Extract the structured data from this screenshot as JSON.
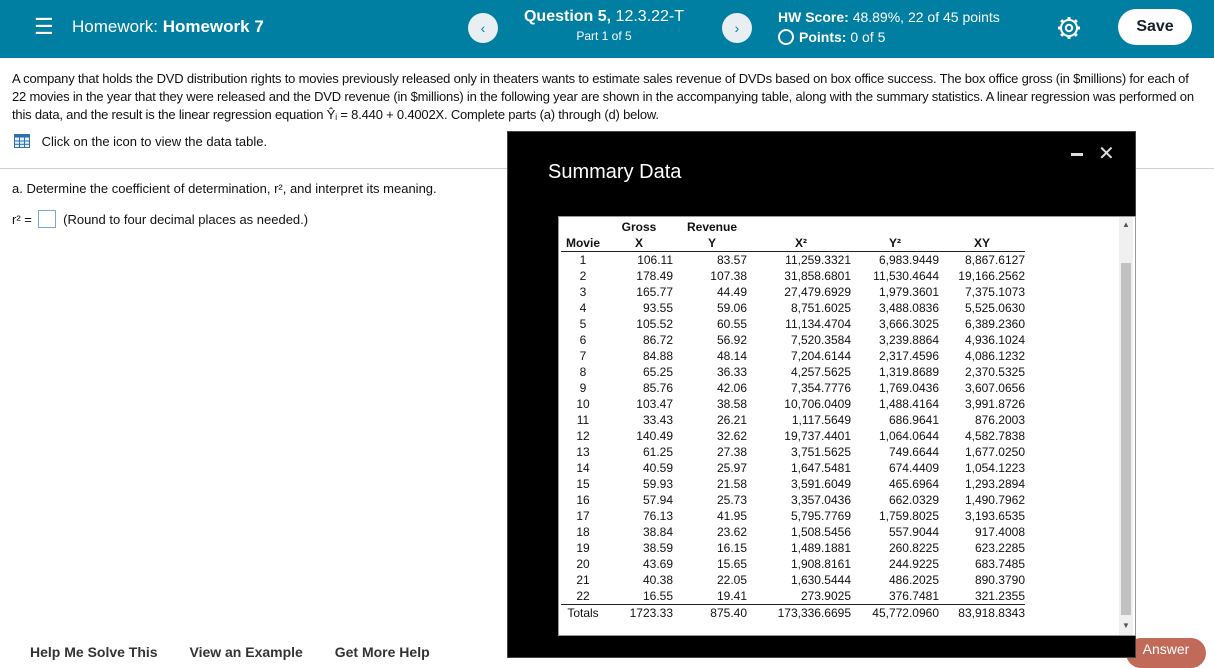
{
  "header": {
    "menu_icon": "hamburger-icon",
    "hw_prefix": "Homework:",
    "hw_name": "Homework 7",
    "question_label": "Question 5,",
    "question_id": "12.3.22-T",
    "part": "Part 1 of 5",
    "score_label": "HW Score:",
    "score_value": "48.89%, 22 of 45 points",
    "points_label": "Points:",
    "points_value": "0 of 5",
    "save_label": "Save",
    "prev_icon": "chevron-left-icon",
    "next_icon": "chevron-right-icon",
    "settings_icon": "gear-icon"
  },
  "problem": {
    "text_1": "A company that holds the DVD distribution rights to movies previously released only in theaters wants to estimate sales revenue of DVDs based on box office success. The box office gross (in $millions) for each of 22 movies in the year that they were released and the DVD revenue (in $millions) in the following year are shown in the accompanying table, along with the summary statistics. A linear regression was performed on this data, and the result is the linear regression equation",
    "equation": "Ŷᵢ = 8.440 + 0.4002X.",
    "text_2": "Complete parts (a) through (d) below.",
    "data_link": "Click on the icon to view the data table.",
    "part_a": "a. Determine the coefficient of determination, r², and interpret its meaning.",
    "r2_label": "r² =",
    "round_note": "(Round to four decimal places as needed.)"
  },
  "footer": {
    "help_solve": "Help Me Solve This",
    "view_example": "View an Example",
    "more_help": "Get More Help",
    "answer_label": "Answer"
  },
  "modal": {
    "title": "Summary Data",
    "headers": {
      "movie": "Movie",
      "gross_top": "Gross",
      "gross_bot": "X",
      "rev_top": "Revenue",
      "rev_bot": "Y",
      "x2": "X²",
      "y2": "Y²",
      "xy": "XY"
    },
    "rows": [
      [
        "1",
        "106.11",
        "83.57",
        "11,259.3321",
        "6,983.9449",
        "8,867.6127"
      ],
      [
        "2",
        "178.49",
        "107.38",
        "31,858.6801",
        "11,530.4644",
        "19,166.2562"
      ],
      [
        "3",
        "165.77",
        "44.49",
        "27,479.6929",
        "1,979.3601",
        "7,375.1073"
      ],
      [
        "4",
        "93.55",
        "59.06",
        "8,751.6025",
        "3,488.0836",
        "5,525.0630"
      ],
      [
        "5",
        "105.52",
        "60.55",
        "11,134.4704",
        "3,666.3025",
        "6,389.2360"
      ],
      [
        "6",
        "86.72",
        "56.92",
        "7,520.3584",
        "3,239.8864",
        "4,936.1024"
      ],
      [
        "7",
        "84.88",
        "48.14",
        "7,204.6144",
        "2,317.4596",
        "4,086.1232"
      ],
      [
        "8",
        "65.25",
        "36.33",
        "4,257.5625",
        "1,319.8689",
        "2,370.5325"
      ],
      [
        "9",
        "85.76",
        "42.06",
        "7,354.7776",
        "1,769.0436",
        "3,607.0656"
      ],
      [
        "10",
        "103.47",
        "38.58",
        "10,706.0409",
        "1,488.4164",
        "3,991.8726"
      ],
      [
        "11",
        "33.43",
        "26.21",
        "1,117.5649",
        "686.9641",
        "876.2003"
      ],
      [
        "12",
        "140.49",
        "32.62",
        "19,737.4401",
        "1,064.0644",
        "4,582.7838"
      ],
      [
        "13",
        "61.25",
        "27.38",
        "3,751.5625",
        "749.6644",
        "1,677.0250"
      ],
      [
        "14",
        "40.59",
        "25.97",
        "1,647.5481",
        "674.4409",
        "1,054.1223"
      ],
      [
        "15",
        "59.93",
        "21.58",
        "3,591.6049",
        "465.6964",
        "1,293.2894"
      ],
      [
        "16",
        "57.94",
        "25.73",
        "3,357.0436",
        "662.0329",
        "1,490.7962"
      ],
      [
        "17",
        "76.13",
        "41.95",
        "5,795.7769",
        "1,759.8025",
        "3,193.6535"
      ],
      [
        "18",
        "38.84",
        "23.62",
        "1,508.5456",
        "557.9044",
        "917.4008"
      ],
      [
        "19",
        "38.59",
        "16.15",
        "1,489.1881",
        "260.8225",
        "623.2285"
      ],
      [
        "20",
        "43.69",
        "15.65",
        "1,908.8161",
        "244.9225",
        "683.7485"
      ],
      [
        "21",
        "40.38",
        "22.05",
        "1,630.5444",
        "486.2025",
        "890.3790"
      ],
      [
        "22",
        "16.55",
        "19.41",
        "273.9025",
        "376.7481",
        "321.2355"
      ]
    ],
    "totals": [
      "Totals",
      "1723.33",
      "875.40",
      "173,336.6695",
      "45,772.0960",
      "83,918.8343"
    ]
  }
}
